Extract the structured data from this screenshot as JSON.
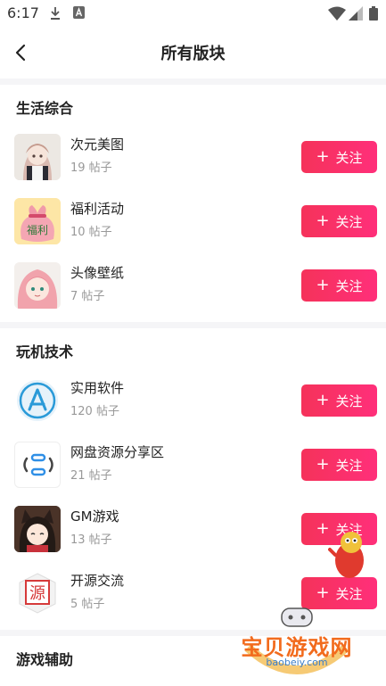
{
  "status_bar": {
    "time": "6:17"
  },
  "header": {
    "title": "所有版块"
  },
  "sections": [
    {
      "title": "生活综合",
      "boards": [
        {
          "name": "次元美图",
          "count": "19 帖子",
          "thumb": "anime-girl-maid"
        },
        {
          "name": "福利活动",
          "count": "10 帖子",
          "thumb": "lucky-bag"
        },
        {
          "name": "头像壁纸",
          "count": "7 帖子",
          "thumb": "pink-hair-girl"
        }
      ]
    },
    {
      "title": "玩机技术",
      "boards": [
        {
          "name": "实用软件",
          "count": "120 帖子",
          "thumb": "app-store-icon"
        },
        {
          "name": "网盘资源分享区",
          "count": "21 帖子",
          "thumb": "cloud-link-icon"
        },
        {
          "name": "GM游戏",
          "count": "13 帖子",
          "thumb": "cat-ear-girl"
        },
        {
          "name": "开源交流",
          "count": "5 帖子",
          "thumb": "yuan-character"
        }
      ]
    },
    {
      "title": "游戏辅助",
      "boards": []
    }
  ],
  "follow_label": "关注",
  "thumb_text": {
    "lucky_bag": "福利",
    "yuan": "源"
  },
  "watermark": {
    "text": "宝贝游戏网",
    "url": "baobeiy.com"
  },
  "colors": {
    "accent_start": "#f5325a",
    "accent_end": "#ff2f7a"
  }
}
